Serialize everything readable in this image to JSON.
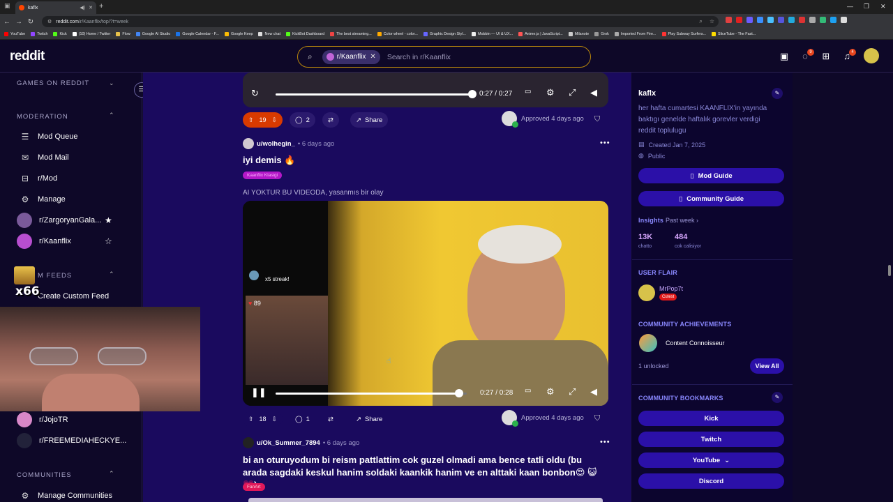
{
  "browser": {
    "tab_title": "kaflx",
    "url_host": "reddit.com",
    "url_path": "/r/Kaanflix/top/?t=week",
    "bookmarks": [
      "YouTube",
      "Twitch",
      "Kick",
      "(10) Home / Twitter",
      "Flow",
      "Google AI Studio",
      "Google Calendar - F...",
      "Google Keep",
      "New chat",
      "KickBot Dashboard",
      "The best streaming...",
      "Color wheel - color...",
      "Graphic Design Styl...",
      "Mobbin — UI & UX...",
      "Anime.js | JavaScript...",
      "Milanote",
      "Grok",
      "Imported From Fire...",
      "Play Subway Surfers...",
      "SliceTube - The Fast..."
    ]
  },
  "header": {
    "logo": "reddit",
    "search_chip": "r/Kaanflix",
    "search_placeholder": "Search in r/Kaanflix",
    "chat_badge": "9",
    "notif_badge": "4"
  },
  "sidebar": {
    "games_label": "GAMES ON REDDIT",
    "moderation_label": "MODERATION",
    "mod_items": [
      {
        "label": "Mod Queue",
        "icon": "mod-queue-icon"
      },
      {
        "label": "Mod Mail",
        "icon": "mail-icon"
      },
      {
        "label": "r/Mod",
        "icon": "mod-icon"
      },
      {
        "label": "Manage",
        "icon": "gear-icon"
      }
    ],
    "communities_mod": [
      {
        "label": "r/ZargoryanGala...",
        "starred": true
      },
      {
        "label": "r/Kaanflix",
        "starred": false
      }
    ],
    "feeds_label": "M FEEDS",
    "create_feed": "Create Custom Feed",
    "overlay_text": "x66",
    "more_communities": [
      "r/JojoTR",
      "r/FREEMEDIAHECKYE..."
    ],
    "communities_label": "COMMUNITIES",
    "manage_communities": "Manage Communities"
  },
  "feed": {
    "post0": {
      "video_time": "0:27 / 0:27",
      "progress": 1.0,
      "votes": "19",
      "comments": "2",
      "share": "Share",
      "approved": "Approved 4 days ago"
    },
    "post1": {
      "user": "u/wolhegin_",
      "time": "• 6 days ago",
      "title": "iyi demis 🔥",
      "flair": "Kaanflix Klasigi",
      "body": "AI YOKTUR BU VIDEODA, yasanmıs bir olay",
      "streak": "x5 streak!",
      "hearts": "89",
      "video_time": "0:27 / 0:28",
      "progress": 0.96,
      "votes": "18",
      "comments": "1",
      "share": "Share",
      "approved": "Approved 4 days ago"
    },
    "post2": {
      "user": "u/Ok_Summer_7894",
      "time": "• 6 days ago",
      "title": "bi an oturuyodum bi reism pattlattim cok guzel olmadi ama bence tatli oldu (bu arada sagdaki keskul hanim soldaki kaankik hanim ve en alttaki kaan bonbon😍 😺 💗)",
      "flair": "FanArt"
    }
  },
  "rsidebar": {
    "name": "kaflx",
    "description": "her hafta cumartesi KAANFLIX'in yayında baktıgı genelde haftalık gorevler verdigi reddit toplulugu",
    "created": "Created Jan 7, 2025",
    "visibility": "Public",
    "mod_guide": "Mod Guide",
    "community_guide": "Community Guide",
    "insights": "Insights",
    "insights_period": "Past week",
    "stat1_value": "13K",
    "stat1_label": "chatto",
    "stat2_value": "484",
    "stat2_label": "cok calisiyor",
    "user_flair_head": "USER FLAIR",
    "flair_user": "MrPop7t",
    "flair_tag": "Cutest",
    "achievements_head": "COMMUNITY ACHIEVEMENTS",
    "achievement": "Content Connoisseur",
    "unlocked": "1 unlocked",
    "view_all": "View All",
    "bookmarks_head": "COMMUNITY BOOKMARKS",
    "bookmarks": [
      "Kick",
      "Twitch",
      "YouTube",
      "Discord"
    ]
  },
  "colors": {
    "feed_bg": "#1a0a5e",
    "sidebar_bg": "#0e0828",
    "button_bg": "#2b10a8",
    "upvote_active": "#d93a00",
    "accent_text": "#8a88d8"
  }
}
